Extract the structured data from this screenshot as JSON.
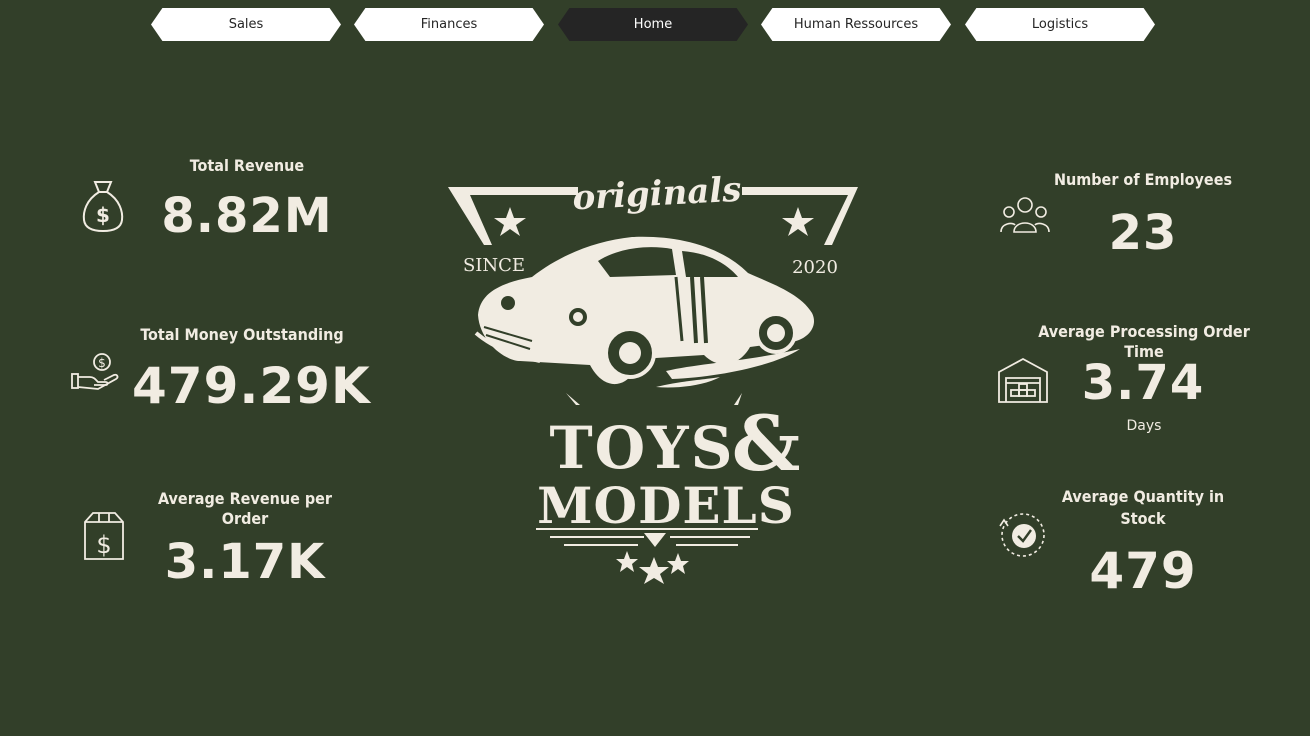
{
  "nav": {
    "tabs": [
      {
        "label": "Sales",
        "active": false
      },
      {
        "label": "Finances",
        "active": false
      },
      {
        "label": "Home",
        "active": true
      },
      {
        "label": "Human Ressources",
        "active": false
      },
      {
        "label": "Logistics",
        "active": false
      }
    ]
  },
  "kpis_left": [
    {
      "label": "Total Revenue",
      "value": "8.82M",
      "icon": "money-bag-icon"
    },
    {
      "label": "Total Money Outstanding",
      "value": "479.29K",
      "icon": "hand-coin-icon"
    },
    {
      "label": "Average Revenue per Order",
      "value": "3.17K",
      "icon": "dollar-box-icon"
    }
  ],
  "kpis_right": [
    {
      "label": "Number of Employees",
      "value": "23",
      "icon": "people-group-icon"
    },
    {
      "label": "Average Processing Order Time",
      "value": "3.74",
      "unit": "Days",
      "icon": "warehouse-icon"
    },
    {
      "label": "Average Quantity in Stock",
      "value": "479",
      "icon": "clock-check-icon"
    }
  ],
  "logo": {
    "top_word": "originals",
    "since_label": "SINCE",
    "year": "2020",
    "line1": "TOYS",
    "ampersand": "&",
    "line2": "MODELS"
  },
  "colors": {
    "background": "#323f29",
    "foreground": "#f1ece2",
    "tab_inactive": "#ffffff",
    "tab_active": "#252525"
  }
}
